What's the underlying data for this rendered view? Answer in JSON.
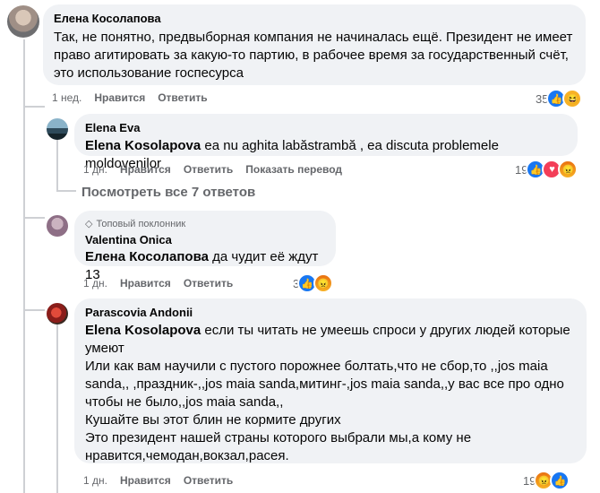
{
  "comments": [
    {
      "author": "Елена Косолапова",
      "text": "Так, не понятно, предвыборная компания не начиналась ещё. Президент не имеет\nправо агитировать за какую-то партию, в рабочее время за государственный счёт,\nэто использование госпесурса",
      "time": "1 нед.",
      "like": "Нравится",
      "reply": "Ответить",
      "reaction_count": "35",
      "reactions": [
        "like-icon",
        "haha-icon"
      ]
    },
    {
      "author": "Elena Eva",
      "mention": "Elena Kosolapova",
      "text": " ea nu aghita labăstrambă , ea discuta problemele moldovenilor",
      "time": "1 дн.",
      "like": "Нравится",
      "reply": "Ответить",
      "translate": "Показать перевод",
      "reaction_count": "19",
      "reactions": [
        "like-icon",
        "love-icon",
        "angry-icon"
      ]
    },
    {
      "view_replies": "Посмотреть все 7 ответов"
    },
    {
      "badge": "Топовый поклонник",
      "author": "Valentina Onica",
      "mention": "Елена Косолапова",
      "text": " да чудит её ждут 13",
      "time": "1 дн.",
      "like": "Нравится",
      "reply": "Ответить",
      "reaction_count": "3",
      "reactions": [
        "like-icon",
        "angry-icon"
      ]
    },
    {
      "author": "Parascovia Andonii",
      "mention": "Elena Kosolapova",
      "text": " если ты читать не умеешь спроси у других людей которые\nумеют\nИли как вам научили с пустого порожнее болтать,что не сбор,то ,,jos maia\nsanda,, ,праздник-,,jos maia sanda,митинг-,jos maia sanda,,у вас все про одно\nчтобы не было,,jos maia sanda,,\nКушайте вы этот блин не кормите других\nЭто президент нашей страны которого выбрали мы,а кому не\nнравится,чемодан,вокзал,расея.",
      "time": "1 дн.",
      "like": "Нравится",
      "reply": "Ответить",
      "reaction_count": "19",
      "reactions": [
        "angry-icon",
        "like-icon"
      ]
    }
  ],
  "colors": {
    "bubble": "#f0f2f5",
    "like": "#1877f2",
    "love": "#f33e58",
    "angry": "#e9710f",
    "haha": "#f7b125",
    "secondary_text": "#65676b"
  }
}
